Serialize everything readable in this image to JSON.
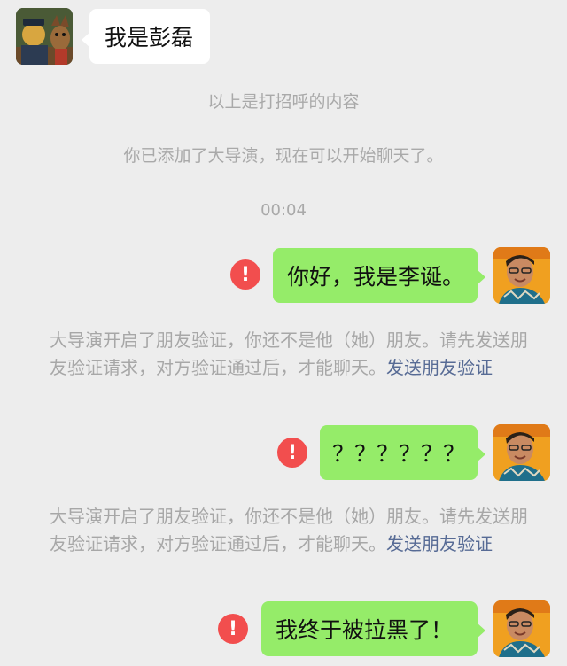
{
  "contact": {
    "avatar_icon": "cartoon-avatar-icon",
    "greeting": "我是彭磊"
  },
  "system": {
    "greeting_note": "以上是打招呼的内容",
    "added_note": "你已添加了大导演，现在可以开始聊天了。",
    "time": "00:04"
  },
  "self": {
    "avatar_icon": "user-photo-avatar-icon"
  },
  "messages": [
    {
      "text": "你好，我是李诞。",
      "status": "failed"
    },
    {
      "text": "？？？？？？",
      "status": "failed"
    },
    {
      "text": "我终于被拉黑了！",
      "status": "failed"
    }
  ],
  "notice": {
    "text": "大导演开启了朋友验证，你还不是他（她）朋友。请先发送朋友验证请求，对方验证通过后，才能聊天。",
    "link": "发送朋友验证"
  },
  "error_glyph": "!",
  "colors": {
    "background": "#ededed",
    "bubble_out": "#95ec69",
    "bubble_in": "#ffffff",
    "error": "#f24e4e",
    "link": "#576b95"
  }
}
